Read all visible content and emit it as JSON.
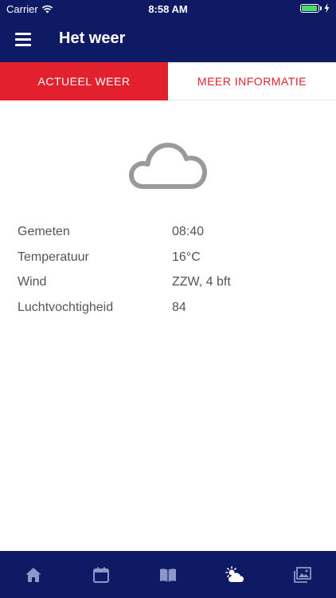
{
  "status_bar": {
    "carrier": "Carrier",
    "time": "8:58 AM",
    "battery_level": 0.95,
    "battery_color": "#4cd964"
  },
  "header": {
    "title": "Het weer"
  },
  "tabs": [
    {
      "label": "ACTUEEL WEER",
      "active": true
    },
    {
      "label": "MEER INFORMATIE",
      "active": false
    }
  ],
  "weather": {
    "icon": "cloud-icon"
  },
  "details": [
    {
      "label": "Gemeten",
      "value": "08:40"
    },
    {
      "label": "Temperatuur",
      "value": "16°C"
    },
    {
      "label": "Wind",
      "value": "ZZW, 4 bft"
    },
    {
      "label": "Luchtvochtigheid",
      "value": "84"
    }
  ],
  "bottom_nav": [
    {
      "icon": "home-icon",
      "active": false
    },
    {
      "icon": "calendar-icon",
      "active": false
    },
    {
      "icon": "book-icon",
      "active": false
    },
    {
      "icon": "weather-icon",
      "active": true
    },
    {
      "icon": "gallery-icon",
      "active": false
    }
  ],
  "colors": {
    "primary": "#0e1a63",
    "accent": "#e3202e",
    "text": "#555555",
    "icon_gray": "#9a9a9a",
    "nav_icon": "#8e97c9"
  }
}
